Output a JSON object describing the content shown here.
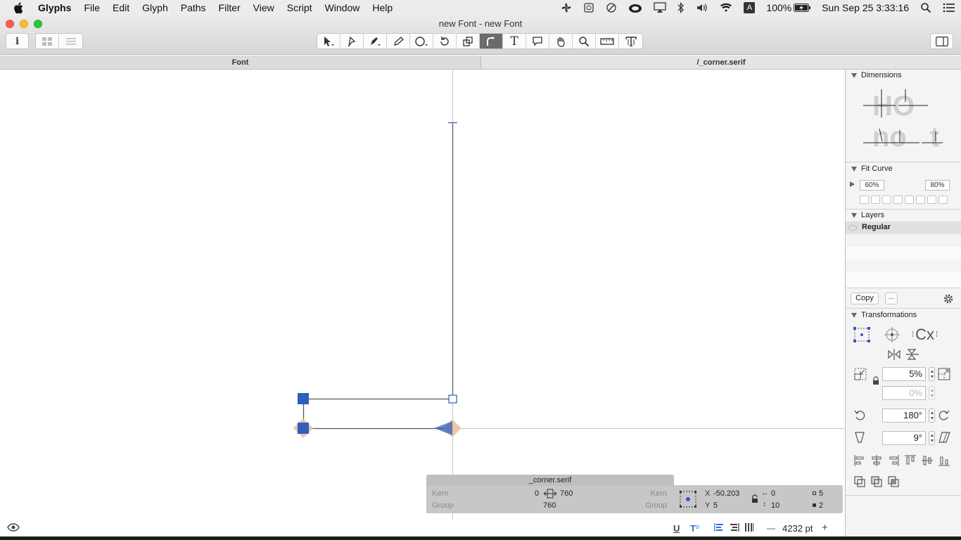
{
  "menubar": {
    "app": "Glyphs",
    "items": [
      "File",
      "Edit",
      "Glyph",
      "Paths",
      "Filter",
      "View",
      "Script",
      "Window",
      "Help"
    ],
    "status": {
      "language_badge": "A",
      "battery": "100%",
      "datetime": "Sun Sep 25  3:33:16"
    }
  },
  "window": {
    "title": "new Font - new Font"
  },
  "tabs": {
    "font": "Font",
    "glyph": "/_corner.serif"
  },
  "toolbar": {
    "active_tool": "corner-tool",
    "text_tool_glyph": "T"
  },
  "infobox": {
    "glyph_name": "_corner.serif",
    "kern_left_label": "Kern",
    "kern_right_label": "Kern",
    "group_left_label": "Group",
    "group_right_label": "Group",
    "lsb": "0",
    "rsb": "760",
    "width": "760",
    "x_label": "X",
    "y_label": "Y",
    "x": "-50.203",
    "y": "5",
    "w_value": "0",
    "h_value": "10",
    "count_nodes": "5",
    "count_selected": "2"
  },
  "bottombar": {
    "zoom": "4232 pt",
    "minus": "—",
    "plus": "+"
  },
  "panel": {
    "dimensions_title": "Dimensions",
    "dimensions_preview_upper": "HO",
    "dimensions_preview_lower": "no",
    "dimensions_preview_t": "t",
    "fitcurve_title": "Fit Curve",
    "fit_min": "60%",
    "fit_max": "80%",
    "layers_title": "Layers",
    "layer_name": "Regular",
    "copy_label": "Copy",
    "minus_label": "—",
    "transformations_title": "Transformations",
    "tf_scale": "5%",
    "tf_scale_y": "0%",
    "tf_rotate": "180°",
    "tf_slant": "9°",
    "cx_label": "Cx"
  },
  "colors": {
    "node_blue": "#2f5fbd",
    "anchor_orange": "#e8c2a0",
    "path_gray": "#5a5a5a",
    "guide_gray": "#c8c8c8"
  }
}
